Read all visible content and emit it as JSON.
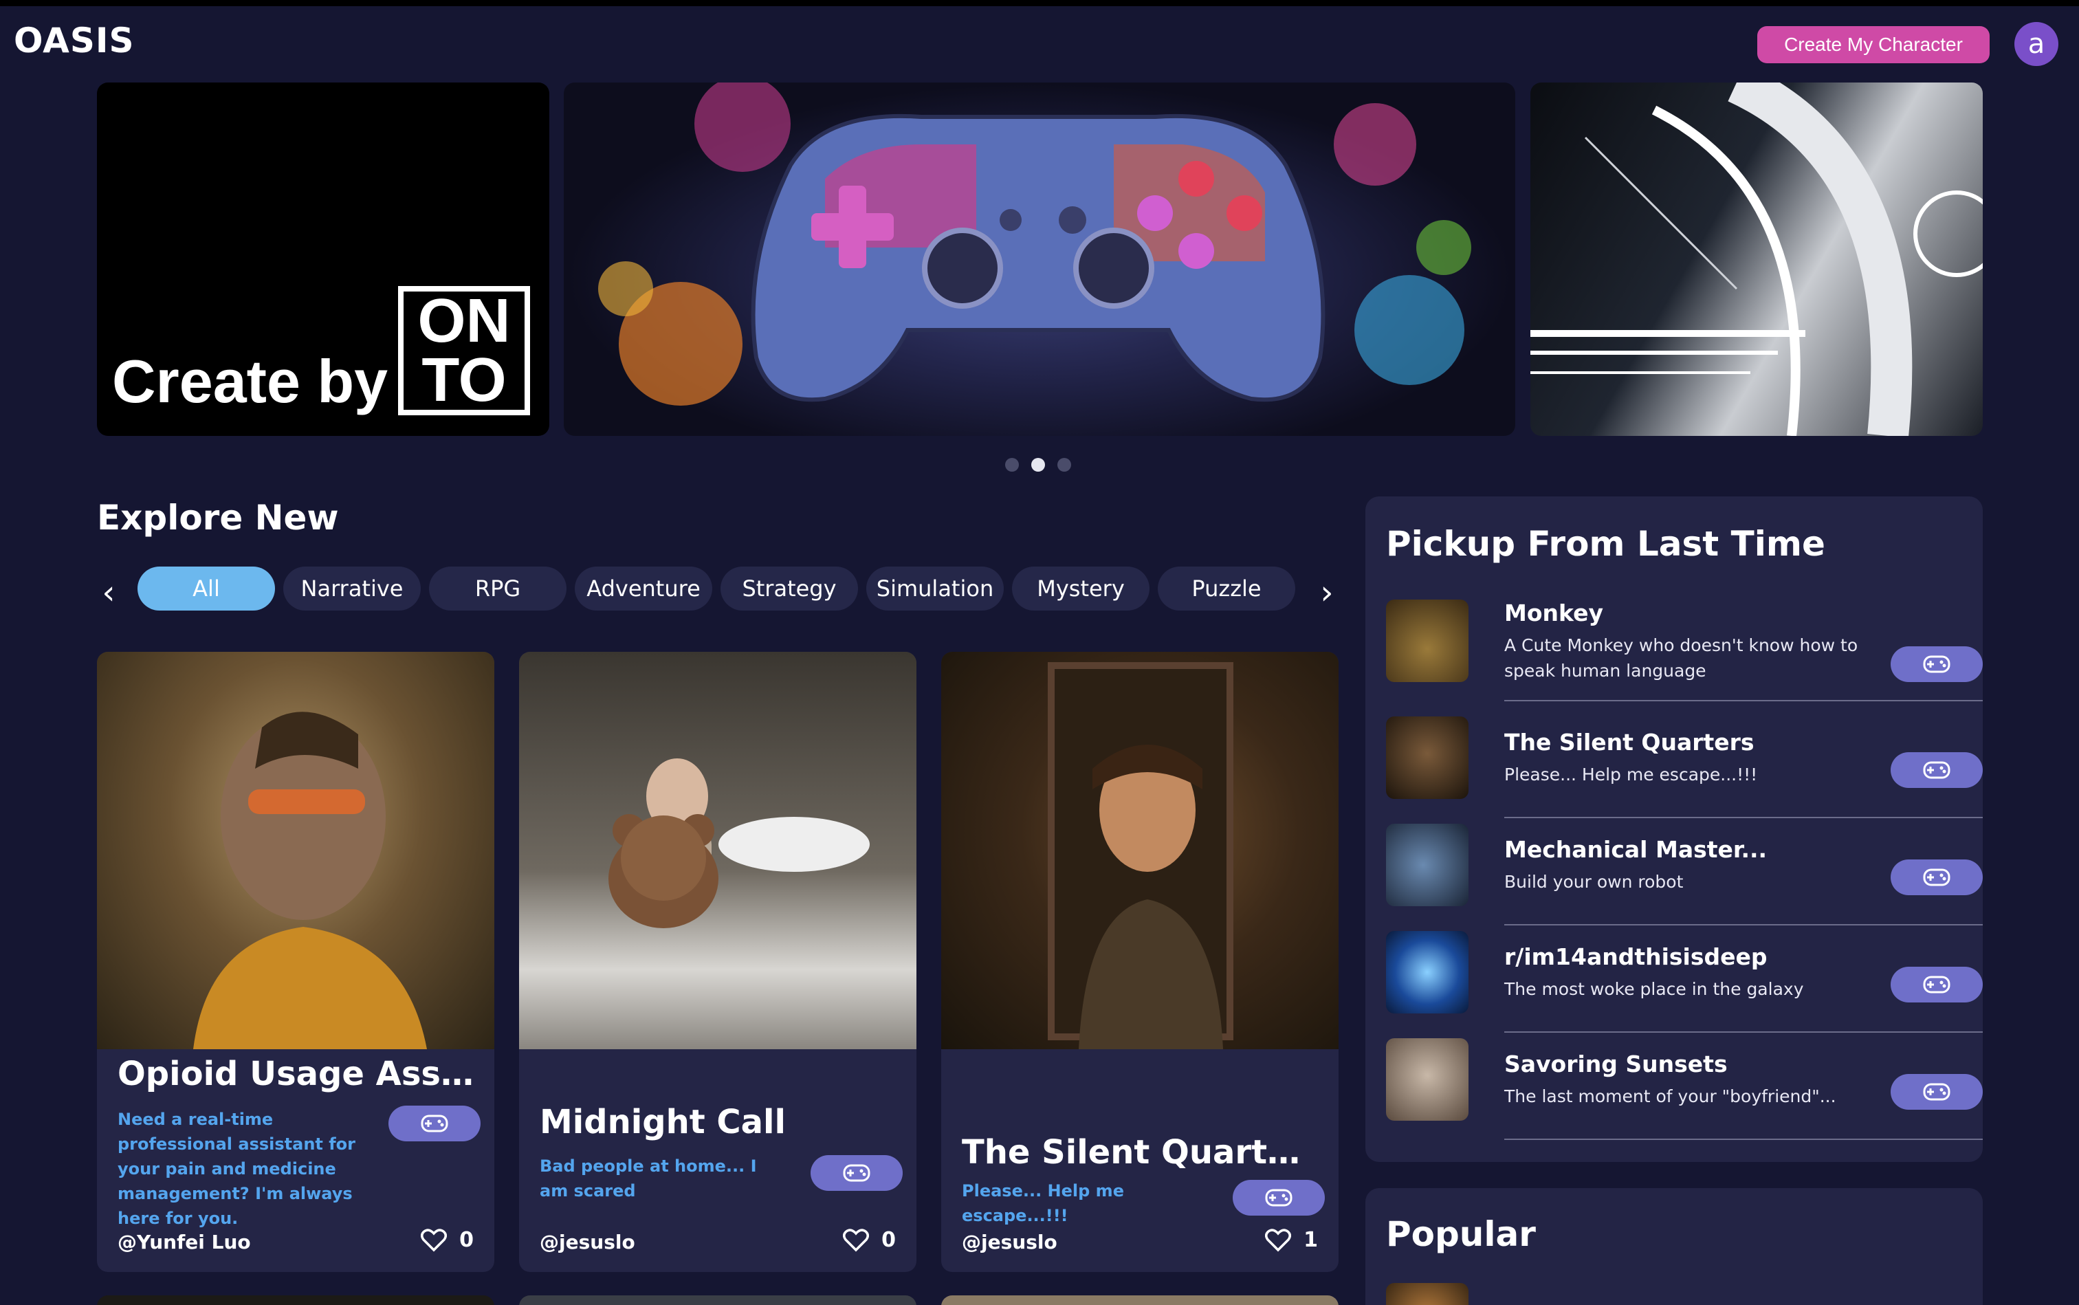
{
  "header": {
    "logo": "OASIS",
    "create_label": "Create My Character",
    "avatar_letter": "a"
  },
  "carousel": {
    "banner1": {
      "text": "Create by",
      "logo_line1": "ON",
      "logo_line2": "TO"
    },
    "dot_count": 3,
    "active_dot": 1
  },
  "explore": {
    "title": "Explore New",
    "chips": [
      "All",
      "Narrative",
      "RPG",
      "Adventure",
      "Strategy",
      "Simulation",
      "Mystery",
      "Puzzle"
    ],
    "active_chip": 0
  },
  "cards": [
    {
      "title": "Opioid Usage Assist...",
      "desc": "Need a real-time professional assistant for your pain and medicine management? I'm always here for you.",
      "author": "@Yunfei Luo",
      "likes": "0"
    },
    {
      "title": "Midnight Call",
      "desc": "Bad people at home... I am scared",
      "author": "@jesuslo",
      "likes": "0"
    },
    {
      "title": "The Silent Quarters",
      "desc": "Please... Help me escape...!!!",
      "author": "@jesuslo",
      "likes": "1"
    }
  ],
  "pickup": {
    "title": "Pickup From Last Time",
    "items": [
      {
        "title": "Monkey",
        "desc": "A Cute Monkey who doesn't know how to speak human language"
      },
      {
        "title": "The Silent Quarters",
        "desc": "Please... Help me escape...!!!"
      },
      {
        "title": "Mechanical Master...",
        "desc": "Build your own robot"
      },
      {
        "title": "r/im14andthisisdeep",
        "desc": "The most woke place in the galaxy"
      },
      {
        "title": "Savoring Sunsets",
        "desc": "The last moment of your \"boyfriend\"..."
      }
    ]
  },
  "popular": {
    "title": "Popular"
  },
  "colors": {
    "background": "#151632",
    "accent_pink": "#cf4aa6",
    "chip_active": "#6cb8ee",
    "play_button": "#6f6fc9",
    "desc_blue": "#54a5ee",
    "panel": "#232445"
  },
  "icons": {
    "play": "gamepad-icon",
    "like": "heart-icon",
    "prev": "chevron-left-icon",
    "next": "chevron-right-icon"
  }
}
